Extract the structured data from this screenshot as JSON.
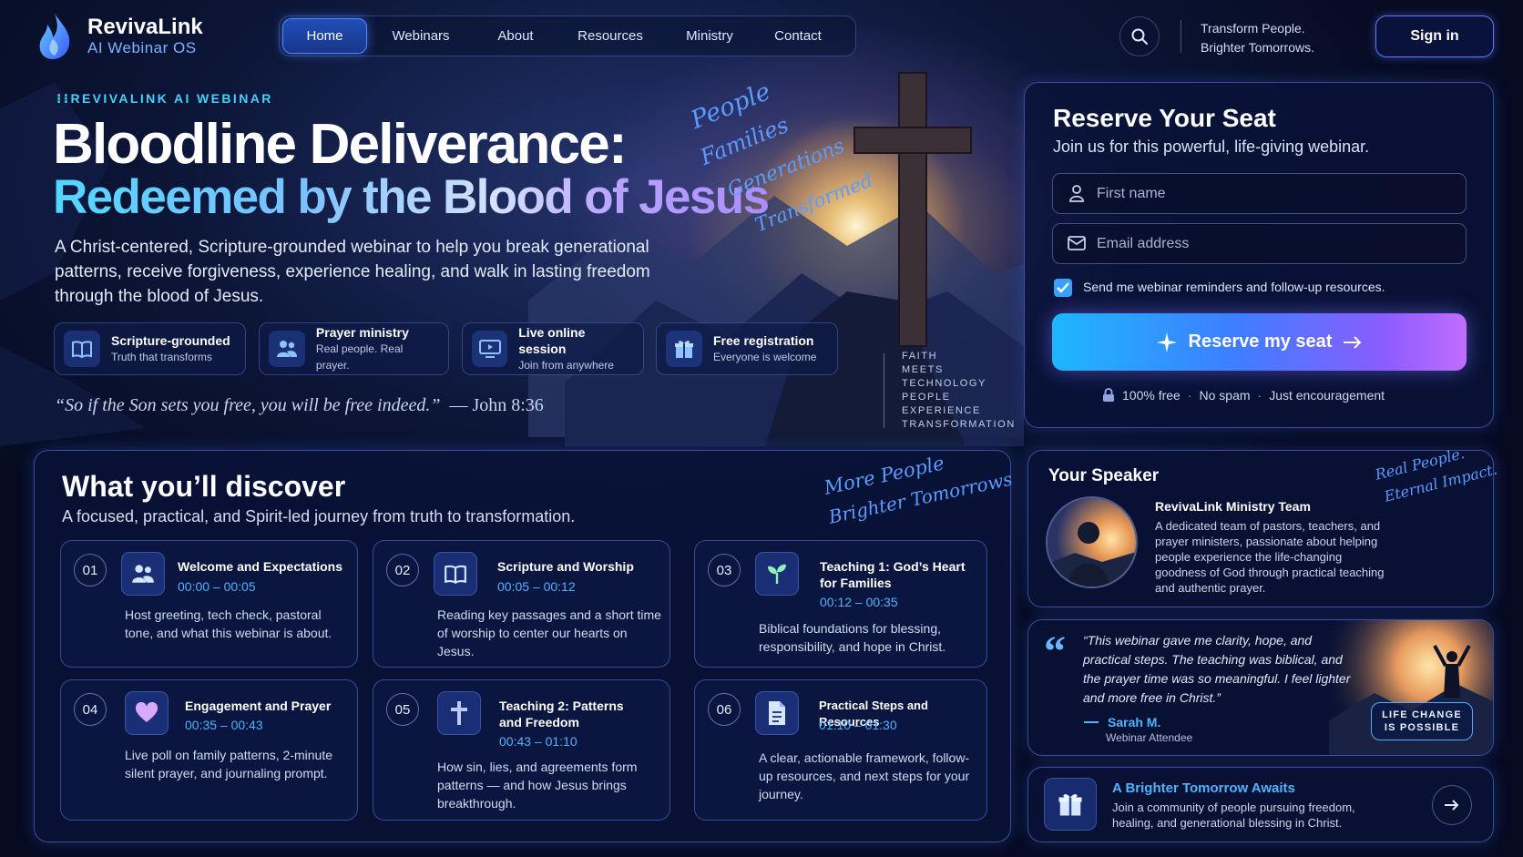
{
  "brand": {
    "name": "RevivaLink",
    "subtitle": "AI Webinar OS"
  },
  "nav": {
    "items": [
      "Home",
      "Webinars",
      "About",
      "Resources",
      "Ministry",
      "Contact"
    ],
    "active": "Home"
  },
  "header": {
    "tagline_line1": "Transform People.",
    "tagline_line2": "Brighter Tomorrows.",
    "sign_in": "Sign in"
  },
  "hero": {
    "eyebrow": "REVIVALINK AI WEBINAR",
    "title_line1": "Bloodline Deliverance:",
    "title_line2": "Redeemed by the Blood of Jesus",
    "description": "A Christ-centered, Scripture-grounded webinar to help you break generational patterns, receive forgiveness, experience healing, and walk in lasting freedom through the blood of Jesus.",
    "features": [
      {
        "title": "Scripture-grounded",
        "subtitle": "Truth that transforms",
        "icon": "book-icon"
      },
      {
        "title": "Prayer ministry",
        "subtitle": "Real people. Real prayer.",
        "icon": "people-icon"
      },
      {
        "title": "Live online session",
        "subtitle": "Join from anywhere",
        "icon": "monitor-icon"
      },
      {
        "title": "Free registration",
        "subtitle": "Everyone is welcome",
        "icon": "gift-icon"
      }
    ],
    "quote": "“So if the Son sets you free, you will be free indeed.”",
    "quote_ref": "— John 8:36",
    "script_words": [
      "People",
      "Families",
      "Generations",
      "Transformed"
    ],
    "vertical_list": [
      "FAITH",
      "MEETS",
      "TECHNOLOGY",
      "PEOPLE",
      "EXPERIENCE",
      "TRANSFORMATION"
    ]
  },
  "reserve": {
    "title": "Reserve Your Seat",
    "subtitle": "Join us for this powerful, life-giving webinar.",
    "first_name_placeholder": "First name",
    "email_placeholder": "Email address",
    "checkbox_label": "Send me webinar reminders and follow-up resources.",
    "checkbox_checked": true,
    "cta": "Reserve my seat",
    "assurance": [
      "100% free",
      "No spam",
      "Just encouragement"
    ]
  },
  "discover": {
    "title": "What you’ll discover",
    "subtitle": "A focused, practical, and Spirit-led journey from truth to transformation.",
    "script_line1": "More People",
    "script_line2": "Brighter Tomorrows",
    "sessions": [
      {
        "num": "01",
        "title": "Welcome and Expectations",
        "time": "00:00 – 00:05",
        "desc": "Host greeting, tech check, pastoral tone, and what this webinar is about.",
        "icon": "people-icon"
      },
      {
        "num": "02",
        "title": "Scripture and Worship",
        "time": "00:05 – 00:12",
        "desc": "Reading key passages and a short time of worship to center our hearts on Jesus.",
        "icon": "book-icon"
      },
      {
        "num": "03",
        "title": "Teaching 1: God’s Heart for Families",
        "time": "00:12 – 00:35",
        "desc": "Biblical foundations for blessing, responsibility, and hope in Christ.",
        "icon": "sprout-icon"
      },
      {
        "num": "04",
        "title": "Engagement and Prayer",
        "time": "00:35 – 00:43",
        "desc": "Live poll on family patterns, 2-minute silent prayer, and journaling prompt.",
        "icon": "heart-icon"
      },
      {
        "num": "05",
        "title": "Teaching 2: Patterns and Freedom",
        "time": "00:43 – 01:10",
        "desc": "How sin, lies, and agreements form patterns — and how Jesus brings breakthrough.",
        "icon": "cross-icon"
      },
      {
        "num": "06",
        "title": "Practical Steps and Resources",
        "time": "01:10 – 01:30",
        "desc": "A clear, actionable framework, follow-up resources, and next steps for your journey.",
        "icon": "document-icon"
      }
    ]
  },
  "speaker": {
    "title": "Your Speaker",
    "name": "RevivaLink Ministry Team",
    "desc": "A dedicated team of pastors, teachers, and prayer ministers, passionate about helping people experience the life-changing goodness of God through practical teaching and authentic prayer.",
    "script_line1": "Real People.",
    "script_line2": "Eternal Impact."
  },
  "testimonial": {
    "text": "“This webinar gave me clarity, hope, and practical steps. The teaching was biblical, and the prayer time was so meaningful. I feel lighter and more free in Christ.”",
    "name": "Sarah M.",
    "role": "Webinar Attendee",
    "badge_line1": "LIFE CHANGE",
    "badge_line2": "IS POSSIBLE"
  },
  "brighter": {
    "title": "A Brighter Tomorrow Awaits",
    "desc": "Join a community of people pursuing freedom, healing, and generational blessing in Christ."
  },
  "colors": {
    "accent": "#45d1ff",
    "primary": "#3f7dff",
    "violet": "#a98dff",
    "bg": "#0c1638"
  }
}
